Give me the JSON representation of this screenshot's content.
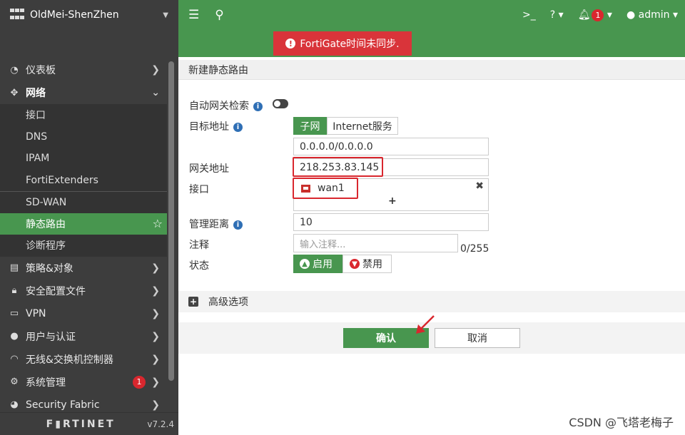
{
  "sidebar": {
    "device_name": "OldMei-ShenZhen",
    "menu": [
      {
        "label": "仪表板"
      },
      {
        "label": "网络"
      },
      {
        "label": "策略&对象"
      },
      {
        "label": "安全配置文件"
      },
      {
        "label": "VPN"
      },
      {
        "label": "用户与认证"
      },
      {
        "label": "无线&交换机控制器"
      },
      {
        "label": "系统管理",
        "badge": "1"
      },
      {
        "label": "Security Fabric"
      }
    ],
    "network_sub": [
      "接口",
      "DNS",
      "IPAM",
      "FortiExtenders",
      "SD-WAN",
      "静态路由",
      "诊断程序"
    ],
    "brand": "F▮RTINET",
    "version": "v7.2.4"
  },
  "topbar": {
    "notification_count": "1",
    "user": "admin"
  },
  "alert": {
    "text": "FortiGate时间未同步."
  },
  "form": {
    "page_title": "新建静态路由",
    "auto_gateway_label": "自动网关检索",
    "destination_label": "目标地址",
    "seg_subnet": "子网",
    "seg_internet": "Internet服务",
    "destination_value": "0.0.0.0/0.0.0.0",
    "gateway_label": "网关地址",
    "gateway_value": "218.253.83.145",
    "interface_label": "接口",
    "interface_value": "wan1",
    "distance_label": "管理距离",
    "distance_value": "10",
    "comment_label": "注释",
    "comment_placeholder": "输入注释...",
    "comment_counter": "0/255",
    "status_label": "状态",
    "status_enable": "启用",
    "status_disable": "禁用",
    "advanced_label": "高级选项",
    "ok_label": "确认",
    "cancel_label": "取消"
  },
  "watermark": "CSDN @飞塔老梅子",
  "colors": {
    "green": "#48964f",
    "sidebar": "#3d3d3d",
    "alert_red": "#d9343a",
    "highlight_red": "#d9272e"
  }
}
